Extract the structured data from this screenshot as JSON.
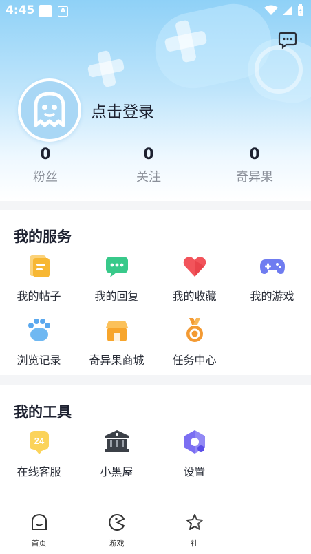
{
  "status_bar": {
    "time": "4:45",
    "notification_letter": "A"
  },
  "profile": {
    "login_label": "点击登录",
    "stats": [
      {
        "value": "0",
        "label": "粉丝"
      },
      {
        "value": "0",
        "label": "关注"
      },
      {
        "value": "0",
        "label": "奇异果"
      }
    ]
  },
  "services": {
    "title": "我的服务",
    "items": [
      {
        "label": "我的帖子",
        "icon": "post-icon",
        "color": "#f7b733"
      },
      {
        "label": "我的回复",
        "icon": "reply-icon",
        "color": "#38c98a"
      },
      {
        "label": "我的收藏",
        "icon": "heart-icon",
        "color": "#f2545b"
      },
      {
        "label": "我的游戏",
        "icon": "gamepad-icon",
        "color": "#6f7cf0"
      },
      {
        "label": "浏览记录",
        "icon": "paw-icon",
        "color": "#5aa8ee"
      },
      {
        "label": "奇异果商城",
        "icon": "shop-icon",
        "color": "#f7a52c"
      },
      {
        "label": "任务中心",
        "icon": "medal-icon",
        "color": "#f39a33"
      }
    ]
  },
  "tools": {
    "title": "我的工具",
    "items": [
      {
        "label": "在线客服",
        "icon": "support-24-icon",
        "badge": "24",
        "color": "#f7c23b"
      },
      {
        "label": "小黑屋",
        "icon": "blackhouse-icon",
        "color": "#3b4047"
      },
      {
        "label": "设置",
        "icon": "settings-icon",
        "color": "#7b6ef2"
      }
    ]
  },
  "tabbar": {
    "tabs": [
      {
        "label": "首页",
        "icon": "home-icon"
      },
      {
        "label": "游戏",
        "icon": "game-tab-icon"
      },
      {
        "label": "社",
        "icon": "community-icon"
      }
    ]
  },
  "colors": {
    "header_top": "#8fd1f7",
    "accent_blue": "#a9d7f5",
    "text_dark": "#1d2130",
    "text_muted": "#8a8f99"
  }
}
